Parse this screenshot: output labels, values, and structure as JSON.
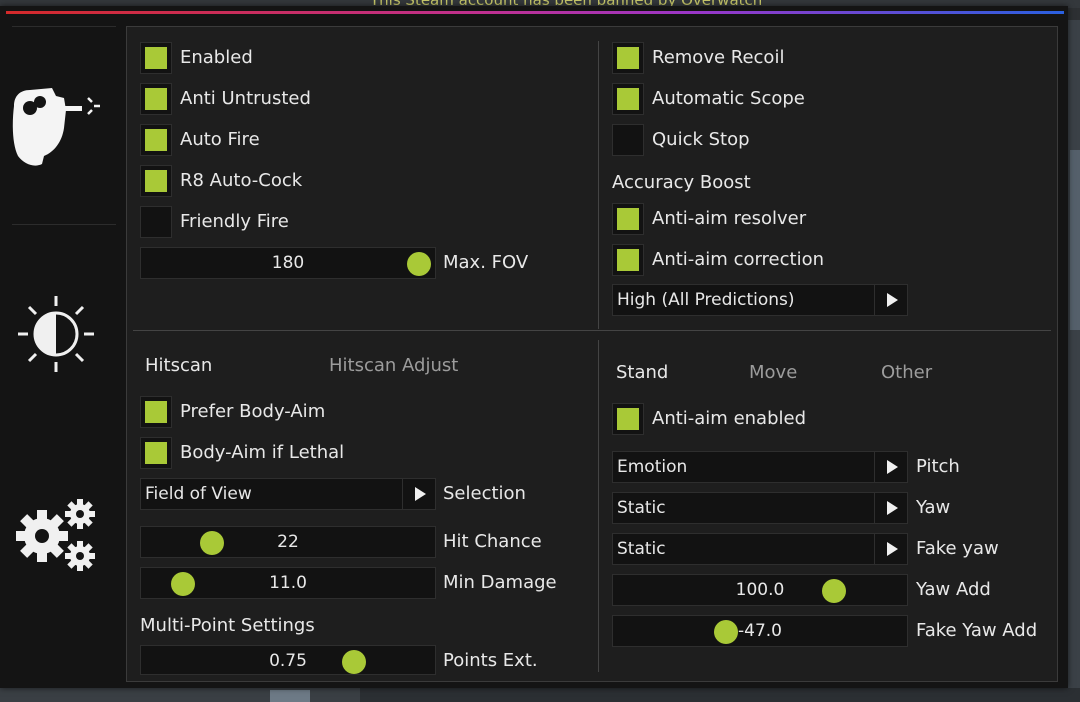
{
  "background": {
    "banner": "This Steam account has been banned by Overwatch"
  },
  "tabs": [
    {
      "icon": "headshot-icon"
    },
    {
      "icon": "brightness-icon"
    },
    {
      "icon": "gears-icon"
    }
  ],
  "colors": {
    "accent": "#a9c937",
    "panel": "#1e1e1e",
    "control": "#121212"
  },
  "aimbot": {
    "left_checkboxes": [
      {
        "label": "Enabled",
        "checked": true
      },
      {
        "label": "Anti Untrusted",
        "checked": true
      },
      {
        "label": "Auto Fire",
        "checked": true
      },
      {
        "label": "R8 Auto-Cock",
        "checked": true
      },
      {
        "label": "Friendly Fire",
        "checked": false
      }
    ],
    "max_fov": {
      "value": "180",
      "label": "Max. FOV"
    },
    "right_checkboxes": [
      {
        "label": "Remove Recoil",
        "checked": true
      },
      {
        "label": "Automatic Scope",
        "checked": true
      },
      {
        "label": "Quick Stop",
        "checked": false
      }
    ],
    "accuracy_boost": {
      "title": "Accuracy Boost",
      "options": [
        {
          "label": "Anti-aim resolver",
          "checked": true
        },
        {
          "label": "Anti-aim correction",
          "checked": true
        }
      ],
      "mode": "High (All Predictions)"
    }
  },
  "hitscan": {
    "tabs": [
      "Hitscan",
      "Hitscan Adjust"
    ],
    "options": [
      {
        "label": "Prefer Body-Aim",
        "checked": true
      },
      {
        "label": "Body-Aim if Lethal",
        "checked": true
      }
    ],
    "selection": {
      "value": "Field of View",
      "label": "Selection"
    },
    "hit_chance": {
      "value": "22",
      "label": "Hit Chance",
      "fraction": 0.2
    },
    "min_damage": {
      "value": "11.0",
      "label": "Min Damage",
      "fraction": 0.11
    },
    "multipoint_title": "Multi-Point Settings",
    "points_ext": {
      "value": "0.75",
      "label": "Points Ext.",
      "fraction": 0.75
    }
  },
  "antiaim": {
    "tabs": [
      "Stand",
      "Move",
      "Other"
    ],
    "enabled": {
      "label": "Anti-aim enabled",
      "checked": true
    },
    "pitch": {
      "value": "Emotion",
      "label": "Pitch"
    },
    "yaw": {
      "value": "Static",
      "label": "Yaw"
    },
    "fake_yaw": {
      "value": "Static",
      "label": "Fake yaw"
    },
    "yaw_add": {
      "value": "100.0",
      "label": "Yaw Add",
      "fraction": 0.78
    },
    "fake_yaw_add": {
      "value": "-47.0",
      "label": "Fake Yaw Add",
      "fraction": 0.37
    }
  }
}
